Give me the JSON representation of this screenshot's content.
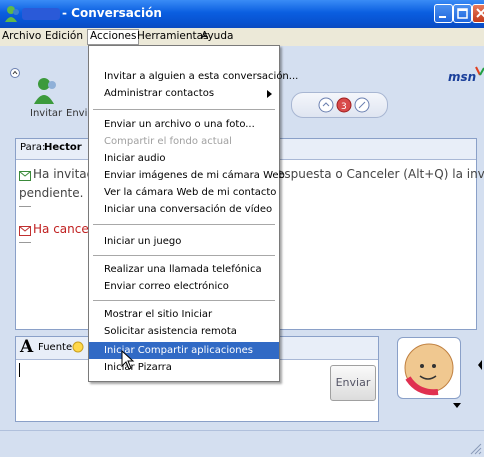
{
  "window": {
    "title": "- Conversación"
  },
  "menubar": {
    "items": [
      "Archivo",
      "Edición",
      "Acciones",
      "Herramientas",
      "Ayuda"
    ]
  },
  "toolbar": {
    "invite_label": "Invitar",
    "send_label": "Envi",
    "logo": "msn"
  },
  "chat": {
    "to_label": "Para:",
    "to_name": "Hector",
    "line1a": "Ha invitad",
    "line1b": "espuesta o Canceler (Alt+Q) la invitación",
    "line2": "pendiente.",
    "line3": "Ha cance"
  },
  "input": {
    "font_label": "Fuente",
    "send_button": "Enviar"
  },
  "menu": {
    "items": [
      {
        "label": "Invitar a alguien a esta conversación...",
        "state": "enabled"
      },
      {
        "label": "Administrar contactos",
        "state": "submenu"
      },
      {
        "label": "Enviar un archivo o una foto...",
        "state": "enabled"
      },
      {
        "label": "Compartir el fondo actual",
        "state": "disabled"
      },
      {
        "label": "Iniciar audio",
        "state": "enabled"
      },
      {
        "label": "Enviar imágenes de mi cámara Web",
        "state": "enabled"
      },
      {
        "label": "Ver la cámara Web de mi contacto",
        "state": "enabled"
      },
      {
        "label": "Iniciar una conversación de vídeo",
        "state": "enabled"
      },
      {
        "label": "Iniciar un juego",
        "state": "enabled"
      },
      {
        "label": "Realizar una llamada telefónica",
        "state": "enabled"
      },
      {
        "label": "Enviar correo electrónico",
        "state": "enabled"
      },
      {
        "label": "Mostrar el sitio Iniciar",
        "state": "enabled"
      },
      {
        "label": "Solicitar asistencia remota",
        "state": "enabled"
      },
      {
        "label": "Iniciar Compartir aplicaciones",
        "state": "highlighted"
      },
      {
        "label": "Iniciar Pizarra",
        "state": "enabled"
      }
    ]
  }
}
